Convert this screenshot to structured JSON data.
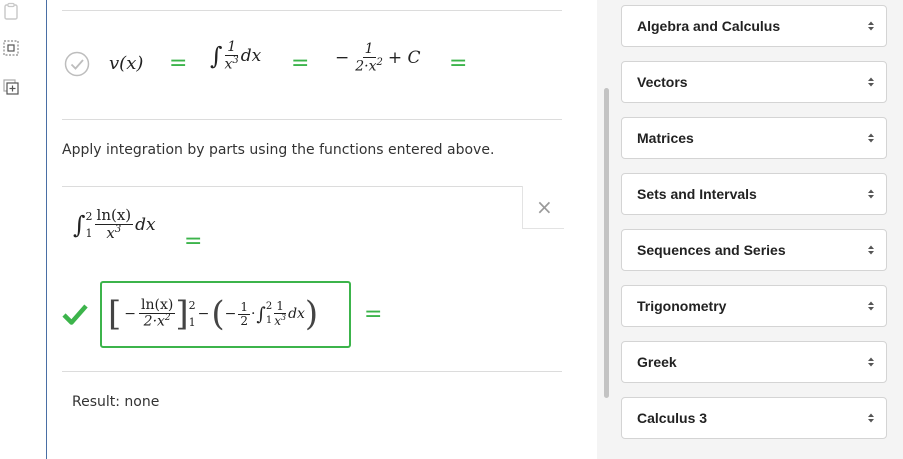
{
  "left_toolbar": {
    "icons": [
      "clipboard-icon",
      "select-box-icon",
      "add-box-icon"
    ]
  },
  "step_v": {
    "lhs": "v(x)",
    "integral_num": "1",
    "integral_den": "x",
    "integral_den_exp": "3",
    "dx": "dx",
    "neg_sign": "−",
    "result_num": "1",
    "result_den": "2·x",
    "result_den_exp": "2",
    "plus_c": "+ C",
    "equals": "="
  },
  "instruction": "Apply integration by parts using the functions entered above.",
  "problem": {
    "upper_limit": "2",
    "lower_limit": "1",
    "num": "ln(x)",
    "den": "x",
    "den_exp": "3",
    "dx": "dx",
    "equals": "="
  },
  "answer": {
    "neg": "−",
    "num": "ln(x)",
    "den": "2·x",
    "den_exp": "2",
    "upper": "2",
    "lower": "1",
    "minus": "−",
    "inner_neg": "−",
    "half_num": "1",
    "half_den": "2",
    "dot": "·",
    "int_upper": "2",
    "int_lower": "1",
    "inner_num": "1",
    "inner_den": "x",
    "inner_den_exp": "3",
    "dx": "dx",
    "equals": "="
  },
  "close_symbol": "×",
  "result_text": "Result: none",
  "categories": [
    "Algebra and Calculus",
    "Vectors",
    "Matrices",
    "Sets and Intervals",
    "Sequences and Series",
    "Trigonometry",
    "Greek",
    "Calculus 3"
  ],
  "colors": {
    "accent_green": "#3cb44b",
    "left_border": "#4a6fa5"
  }
}
